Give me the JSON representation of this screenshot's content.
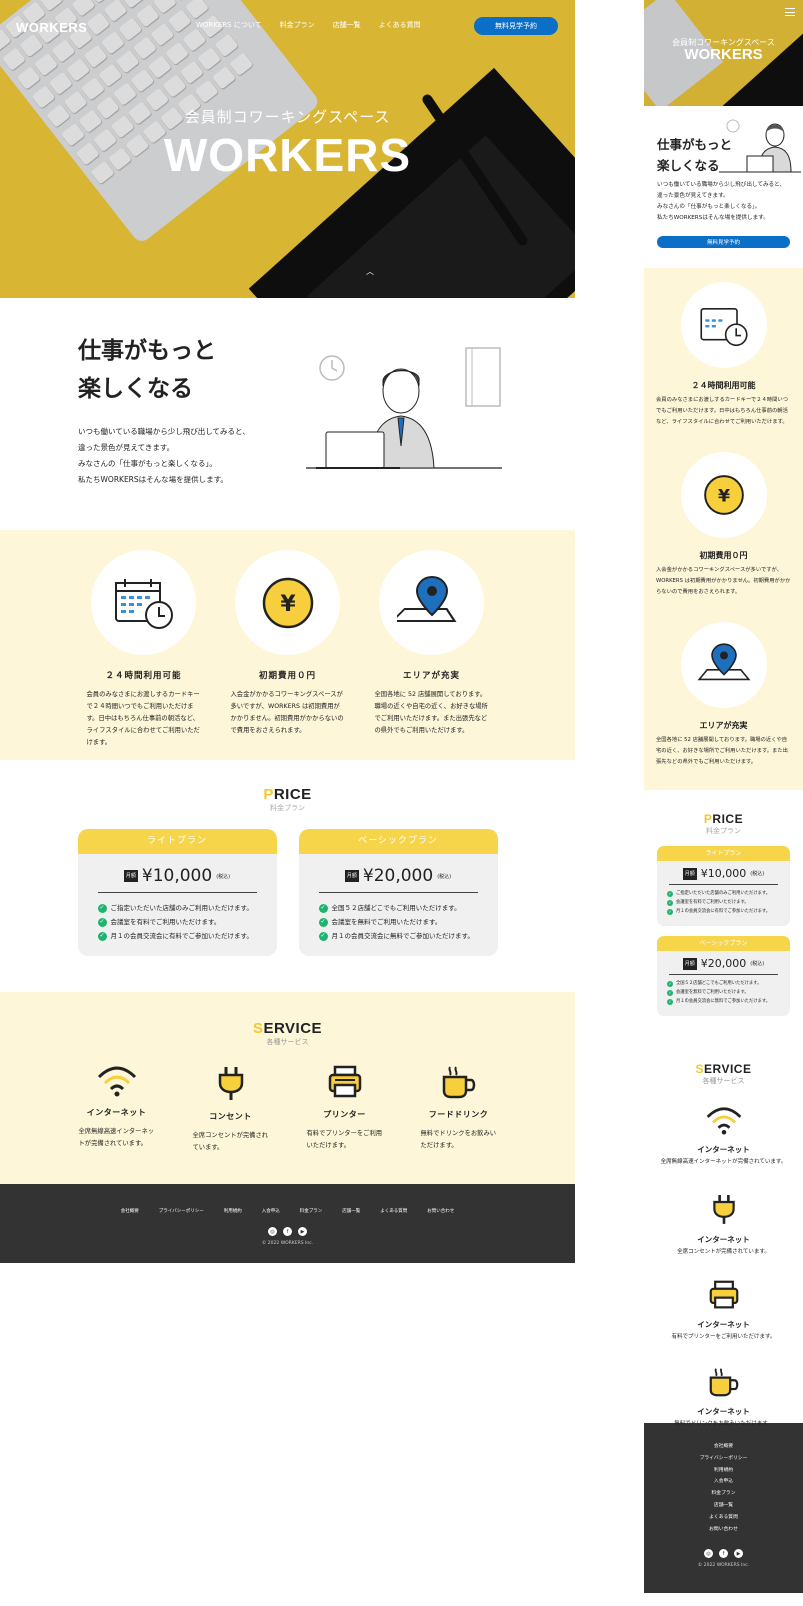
{
  "header": {
    "logo": "WORKERS",
    "nav": [
      "WORKERS について",
      "料金プラン",
      "店舗一覧",
      "よくある質問"
    ],
    "cta": "無料見学予約"
  },
  "hero": {
    "sub": "会員制コワーキングスペース",
    "title": "WORKERS"
  },
  "intro": {
    "title_l1": "仕事がもっと",
    "title_l2": "楽しくなる",
    "p1": "いつも働いている職場から少し飛び出してみると、",
    "p2": "違った景色が見えてきます。",
    "p3": "みなさんの「仕事がもっと楽しくなる」。",
    "p4": "私たちWORKERSはそんな場を提供します。"
  },
  "features": [
    {
      "icon": "calendar-clock-icon",
      "title": "２４時間利用可能",
      "text": "会員のみなさまにお渡しするカードキーで２４時間いつでもご利用いただけます。日中はもちろん仕事前の朝活など、ライフスタイルに合わせてご利用いただけます。"
    },
    {
      "icon": "yen-coin-icon",
      "title": "初期費用０円",
      "text": "入会金がかかるコワーキングスペースが多いですが、WORKERS は初期費用がかかりません。初期費用がかからないので費用をおさえられます。"
    },
    {
      "icon": "map-pin-icon",
      "title": "エリアが充実",
      "text": "全国各地に 52 店舗展開しております。職場の近くや自宅の近く、お好きな場所でご利用いただけます。また出張先などの県外でもご利用いただけます。"
    }
  ],
  "mobile_features": [
    {
      "title": "２４時間利用可能",
      "text": "会員のみなさまにお渡しするカードキーで２４時間いつでもご利用いただけます。日中はもちろん仕事前の朝活など、ライフスタイルに合わせてご利用いただけます。"
    },
    {
      "title": "初期費用０円",
      "text": "入会金がかかるコワーキングスペースが多いですが、WORKERS は初期費用がかかりません。初期費用がかからないので費用をおさえられます。"
    },
    {
      "title": "エリアが充実",
      "text": "全国各地に 52 店舗展開しております。職場の近くや自宅の近く、お好きな場所でご利用いただけます。また出張先などの県外でもご利用いただけます。"
    }
  ],
  "price": {
    "head_first": "P",
    "head_rest": "RICE",
    "sub": "料金プラン",
    "tag": "月額",
    "tax": "(税込)",
    "plans": [
      {
        "name": "ライトプラン",
        "amount": "¥10,000",
        "items": [
          "ご指定いただいた店舗のみご利用いただけます。",
          "会議室を有料でご利用いただけます。",
          "月１の会員交流会に有料でご参加いただけます。"
        ]
      },
      {
        "name": "ベーシックプラン",
        "amount": "¥20,000",
        "items": [
          "全国５２店舗どこでもご利用いただけます。",
          "会議室を無料でご利用いただけます。",
          "月１の会員交流会に無料でご参加いただけます。"
        ]
      }
    ]
  },
  "service": {
    "head_first": "S",
    "head_rest": "ERVICE",
    "sub": "各種サービス",
    "items": [
      {
        "icon": "wifi-icon",
        "title": "インターネット",
        "text": "全席無線高速インターネットが完備されています。"
      },
      {
        "icon": "plug-icon",
        "title": "コンセント",
        "text": "全席コンセントが完備されています。"
      },
      {
        "icon": "printer-icon",
        "title": "プリンター",
        "text": "有料でプリンターをご利用いただけます。"
      },
      {
        "icon": "cup-icon",
        "title": "フードドリンク",
        "text": "無料でドリンクをお飲みいただけます。"
      }
    ],
    "mobile_items": [
      {
        "title": "インターネット",
        "text": "全席無線高速インターネットが完備されています。"
      },
      {
        "title": "インターネット",
        "text": "全席コンセントが完備されています。"
      },
      {
        "title": "インターネット",
        "text": "有料でプリンターをご利用いただけます。"
      },
      {
        "title": "インターネット",
        "text": "無料でドリンクをお飲みいただけます。"
      }
    ]
  },
  "footer": {
    "links": [
      "会社概要",
      "プライバシーポリシー",
      "利用規約",
      "入会申込",
      "料金プラン",
      "店舗一覧",
      "よくある質問",
      "お問い合わせ"
    ],
    "copy": "© 2022 WORKERS Inc."
  },
  "mobile": {
    "hero_sub": "会員制コワーキングスペース",
    "hero_title": "WORKERS",
    "cta": "無料見学予約"
  },
  "colors": {
    "yellow": "#F7CF3C",
    "blue": "#0B6FC7",
    "cream": "#FDF6D8",
    "green": "#1EB46E",
    "footer": "#333333"
  }
}
